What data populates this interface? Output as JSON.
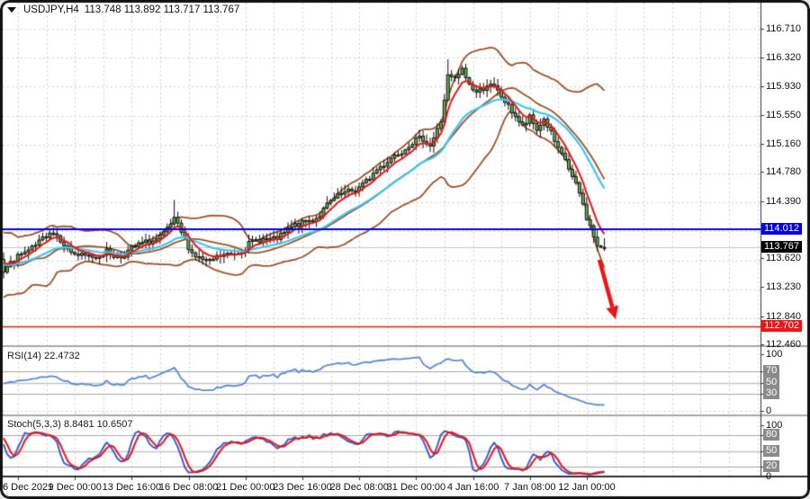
{
  "window": {
    "symbol": "USDJPY,H4",
    "ohlc_text": "113.748 113.892 113.717 113.767",
    "dropdown_icon": "symbol-dropdown-icon"
  },
  "colors": {
    "background": "#ffffff",
    "frame": "#111111",
    "grid": "#cfcfcf",
    "candle_fill": "#63b356",
    "candle_border": "#0c0c0c",
    "bollinger": "#9e5228",
    "ma_fast": "#ee1414",
    "ma_slow": "#3fc6f2",
    "resistance_line": "#0000e6",
    "support_line": "#f01414",
    "bid_line": "#c9c9c9",
    "rsi_line": "#5b87d8",
    "stoch_main": "#3a60d0",
    "stoch_signal": "#ee1414",
    "arrow": "#ee1414",
    "level_line": "#a8a8a8",
    "level_line_mid": "#c6c6c6"
  },
  "price_axis": {
    "labels": [
      "116.710",
      "116.320",
      "115.930",
      "115.550",
      "115.160",
      "114.780",
      "114.390",
      "113.620",
      "113.230",
      "112.840",
      "112.460"
    ],
    "badges": [
      {
        "label": "114.012",
        "price": 114.012,
        "bg": "#0000e6",
        "name": "resistance-price-badge"
      },
      {
        "label": "113.767",
        "price": 113.767,
        "bg": "#000000",
        "name": "bid-price-badge"
      },
      {
        "label": "112.702",
        "price": 112.702,
        "bg": "#f01414",
        "name": "support-price-badge"
      }
    ]
  },
  "x_axis": {
    "labels": [
      "6 Dec 2021",
      "9 Dec 00:00",
      "13 Dec 16:00",
      "16 Dec 08:00",
      "21 Dec 00:00",
      "23 Dec 16:00",
      "28 Dec 08:00",
      "31 Dec 00:00",
      "4 Jan 16:00",
      "7 Jan 08:00",
      "12 Jan 00:00"
    ]
  },
  "rsi_panel": {
    "name": "RSI(14)",
    "value": "22.4732",
    "plain_levels": [
      {
        "label": "100",
        "v": 100
      },
      {
        "label": "0",
        "v": 0
      }
    ],
    "badge_levels": [
      {
        "label": "70",
        "v": 70
      },
      {
        "label": "50",
        "v": 50
      },
      {
        "label": "30",
        "v": 30
      }
    ]
  },
  "stoch_panel": {
    "name": "Stoch(5,3,3)",
    "value": "8.8481 10.6507",
    "plain_levels": [
      {
        "label": "100",
        "v": 100
      },
      {
        "label": "0",
        "v": 0
      }
    ],
    "badge_levels": [
      {
        "label": "80",
        "v": 80
      },
      {
        "label": "50",
        "v": 50
      },
      {
        "label": "20",
        "v": 20
      }
    ]
  },
  "chart_data": {
    "type": "candlestick",
    "symbol": "USDJPY",
    "timeframe": "H4",
    "title": "USDJPY,H4",
    "current_bar": {
      "open": 113.748,
      "high": 113.892,
      "low": 113.717,
      "close": 113.767
    },
    "y_axis": {
      "top_visible": 116.83,
      "bottom_visible": 112.28,
      "grid_top": 116.71,
      "grid_step": 0.39
    },
    "bars": 170,
    "price_path_anchors": [
      [
        0,
        113.45
      ],
      [
        3,
        113.56
      ],
      [
        5,
        113.66
      ],
      [
        9,
        113.82
      ],
      [
        13,
        113.96
      ],
      [
        15,
        113.9
      ],
      [
        19,
        113.74
      ],
      [
        23,
        113.64
      ],
      [
        26,
        113.6
      ],
      [
        29,
        113.72
      ],
      [
        33,
        113.66
      ],
      [
        37,
        113.74
      ],
      [
        41,
        113.86
      ],
      [
        45,
        113.95
      ],
      [
        48,
        114.1
      ],
      [
        51,
        113.86
      ],
      [
        53,
        113.72
      ],
      [
        56,
        113.62
      ],
      [
        58,
        113.55
      ],
      [
        61,
        113.62
      ],
      [
        65,
        113.72
      ],
      [
        69,
        113.8
      ],
      [
        72,
        113.84
      ],
      [
        76,
        113.9
      ],
      [
        80,
        114.0
      ],
      [
        84,
        114.06
      ],
      [
        88,
        114.2
      ],
      [
        91,
        114.34
      ],
      [
        95,
        114.44
      ],
      [
        99,
        114.58
      ],
      [
        103,
        114.7
      ],
      [
        107,
        114.86
      ],
      [
        110,
        115.04
      ],
      [
        114,
        115.16
      ],
      [
        118,
        115.2
      ],
      [
        120,
        115.14
      ],
      [
        123,
        115.5
      ],
      [
        125,
        116.08
      ],
      [
        127,
        116.0
      ],
      [
        129,
        116.12
      ],
      [
        131,
        115.95
      ],
      [
        133,
        115.88
      ],
      [
        136,
        115.98
      ],
      [
        138,
        115.9
      ],
      [
        140,
        115.76
      ],
      [
        142,
        115.64
      ],
      [
        144,
        115.56
      ],
      [
        146,
        115.42
      ],
      [
        148,
        115.52
      ],
      [
        150,
        115.32
      ],
      [
        152,
        115.46
      ],
      [
        154,
        115.3
      ],
      [
        156,
        115.1
      ],
      [
        158,
        114.98
      ],
      [
        160,
        114.7
      ],
      [
        162,
        114.46
      ],
      [
        164,
        114.14
      ],
      [
        166,
        113.92
      ],
      [
        167,
        113.8
      ],
      [
        169,
        113.767
      ]
    ],
    "indicators": {
      "bollinger": {
        "period": 20,
        "deviation": 2
      },
      "ma_fast": {
        "type": "ema",
        "period": 6
      },
      "ma_slow": {
        "type": "ema",
        "period": 21
      },
      "rsi": {
        "period": 14,
        "current": 22.4732,
        "levels": [
          70,
          50,
          30
        ]
      },
      "stochastic": {
        "k": 5,
        "d": 3,
        "slowing": 3,
        "main_current": 8.8481,
        "signal_current": 10.6507,
        "levels": [
          80,
          50,
          20
        ]
      }
    },
    "hlines": [
      {
        "name": "resistance",
        "price": 114.012
      },
      {
        "name": "bid",
        "price": 113.767
      },
      {
        "name": "support",
        "price": 112.702
      }
    ],
    "annotations": [
      {
        "type": "arrow-down",
        "from_price": 113.62,
        "to_price": 112.76,
        "at_end_of_data": true
      }
    ]
  }
}
